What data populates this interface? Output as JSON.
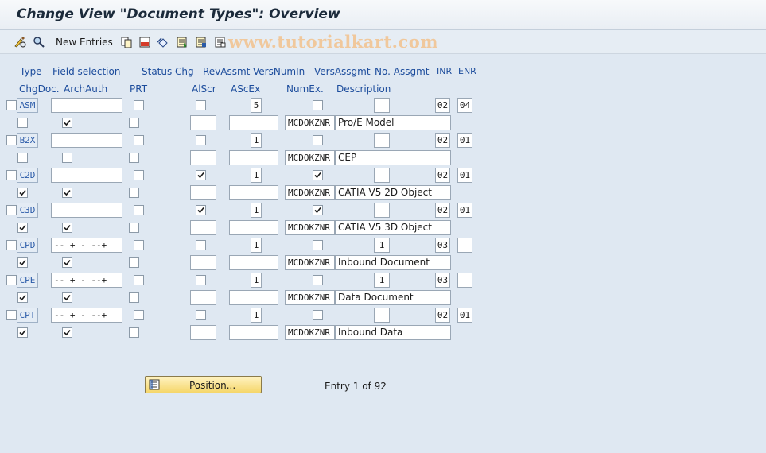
{
  "title": "Change View \"Document Types\": Overview",
  "watermark": "www.tutorialkart.com",
  "toolbar": {
    "new_entries": "New Entries",
    "icons": [
      "display-change-icon",
      "copy-icon",
      "delete-icon",
      "undo-icon",
      "select-all-icon",
      "select-block-icon",
      "deselect-icon"
    ]
  },
  "headers": {
    "row1": [
      "Type",
      "Field selection",
      "Status Chg",
      "RevAssmt",
      "VersNumIn",
      "VersAssgmt",
      "No. Assgmt",
      "INR",
      "ENR"
    ],
    "row2": [
      "ChgDoc.",
      "ArchAuth",
      "PRT",
      "AlScr",
      "AScEx",
      "NumEx.",
      "Description"
    ]
  },
  "entries": [
    {
      "type": "ASM",
      "field_sel": "",
      "status_chg": false,
      "rev_assmt": false,
      "vers_num_in": "5",
      "vers_assgmt": false,
      "no_assgmt": "",
      "inr": "02",
      "enr": "04",
      "chg_doc": false,
      "arch_auth": true,
      "prt": false,
      "al_scr": "",
      "asc_ex": "",
      "num_ex": "MCDOKZNR",
      "description": "Pro/E Model",
      "sel": false
    },
    {
      "type": "B2X",
      "field_sel": "",
      "status_chg": false,
      "rev_assmt": false,
      "vers_num_in": "1",
      "vers_assgmt": false,
      "no_assgmt": "",
      "inr": "02",
      "enr": "01",
      "chg_doc": false,
      "arch_auth": false,
      "prt": false,
      "al_scr": "",
      "asc_ex": "",
      "num_ex": "MCDOKZNR",
      "description": "CEP",
      "sel": false
    },
    {
      "type": "C2D",
      "field_sel": "",
      "status_chg": false,
      "rev_assmt": true,
      "vers_num_in": "1",
      "vers_assgmt": true,
      "no_assgmt": "",
      "inr": "02",
      "enr": "01",
      "chg_doc": true,
      "arch_auth": true,
      "prt": false,
      "al_scr": "",
      "asc_ex": "",
      "num_ex": "MCDOKZNR",
      "description": "CATIA V5 2D Object",
      "sel": false
    },
    {
      "type": "C3D",
      "field_sel": "",
      "status_chg": false,
      "rev_assmt": true,
      "vers_num_in": "1",
      "vers_assgmt": true,
      "no_assgmt": "",
      "inr": "02",
      "enr": "01",
      "chg_doc": true,
      "arch_auth": true,
      "prt": false,
      "al_scr": "",
      "asc_ex": "",
      "num_ex": "MCDOKZNR",
      "description": "CATIA V5 3D Object",
      "sel": false
    },
    {
      "type": "CPD",
      "field_sel": "-- +  - --+",
      "status_chg": false,
      "rev_assmt": false,
      "vers_num_in": "1",
      "vers_assgmt": false,
      "no_assgmt": "1",
      "inr": "03",
      "enr": "",
      "chg_doc": true,
      "arch_auth": true,
      "prt": false,
      "al_scr": "",
      "asc_ex": "",
      "num_ex": "MCDOKZNR",
      "description": "Inbound Document",
      "sel": false
    },
    {
      "type": "CPE",
      "field_sel": "-- +  - --+",
      "status_chg": false,
      "rev_assmt": false,
      "vers_num_in": "1",
      "vers_assgmt": false,
      "no_assgmt": "1",
      "inr": "03",
      "enr": "",
      "chg_doc": true,
      "arch_auth": true,
      "prt": false,
      "al_scr": "",
      "asc_ex": "",
      "num_ex": "MCDOKZNR",
      "description": "Data Document",
      "sel": false
    },
    {
      "type": "CPT",
      "field_sel": "-- +  - --+",
      "status_chg": false,
      "rev_assmt": false,
      "vers_num_in": "1",
      "vers_assgmt": false,
      "no_assgmt": "",
      "inr": "02",
      "enr": "01",
      "chg_doc": true,
      "arch_auth": true,
      "prt": false,
      "al_scr": "",
      "asc_ex": "",
      "num_ex": "MCDOKZNR",
      "description": "Inbound Data",
      "sel": false
    }
  ],
  "position_button": "Position...",
  "entry_info": "Entry 1 of 92"
}
